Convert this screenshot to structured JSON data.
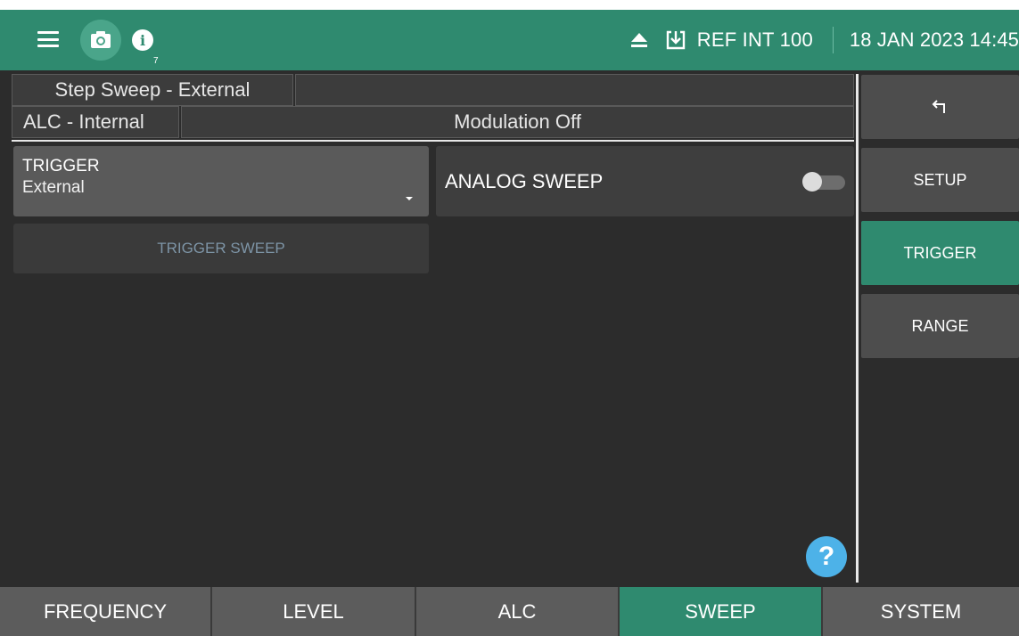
{
  "topbar": {
    "info_badge": "7",
    "ref_text": "REF INT 100",
    "date_text": "18 JAN 2023 14:45",
    "icons": [
      "menu-icon",
      "camera-icon",
      "info-icon",
      "eject-icon",
      "download-icon"
    ],
    "colors": {
      "bar": "#2f8a6f",
      "camera_circle": "#4aa58a"
    }
  },
  "status": {
    "sweep": "Step Sweep - External",
    "sweep_extra": "",
    "alc": "ALC - Internal",
    "modulation": "Modulation Off"
  },
  "main": {
    "trigger_label": "TRIGGER",
    "trigger_value": "External",
    "analog_label": "ANALOG SWEEP",
    "analog_on": false,
    "trigger_sweep_label": "TRIGGER SWEEP",
    "help_symbol": "?"
  },
  "sidebar": {
    "items": [
      {
        "label": "",
        "icon": "back-arrow-icon"
      },
      {
        "label": "SETUP"
      },
      {
        "label": "TRIGGER",
        "active": true
      },
      {
        "label": "RANGE"
      }
    ]
  },
  "tabs": [
    {
      "label": "FREQUENCY"
    },
    {
      "label": "LEVEL"
    },
    {
      "label": "ALC"
    },
    {
      "label": "SWEEP",
      "active": true
    },
    {
      "label": "SYSTEM"
    }
  ],
  "colors": {
    "accent": "#2f8a6f",
    "help": "#4db2e8",
    "disabled_text": "#7d94a6"
  }
}
